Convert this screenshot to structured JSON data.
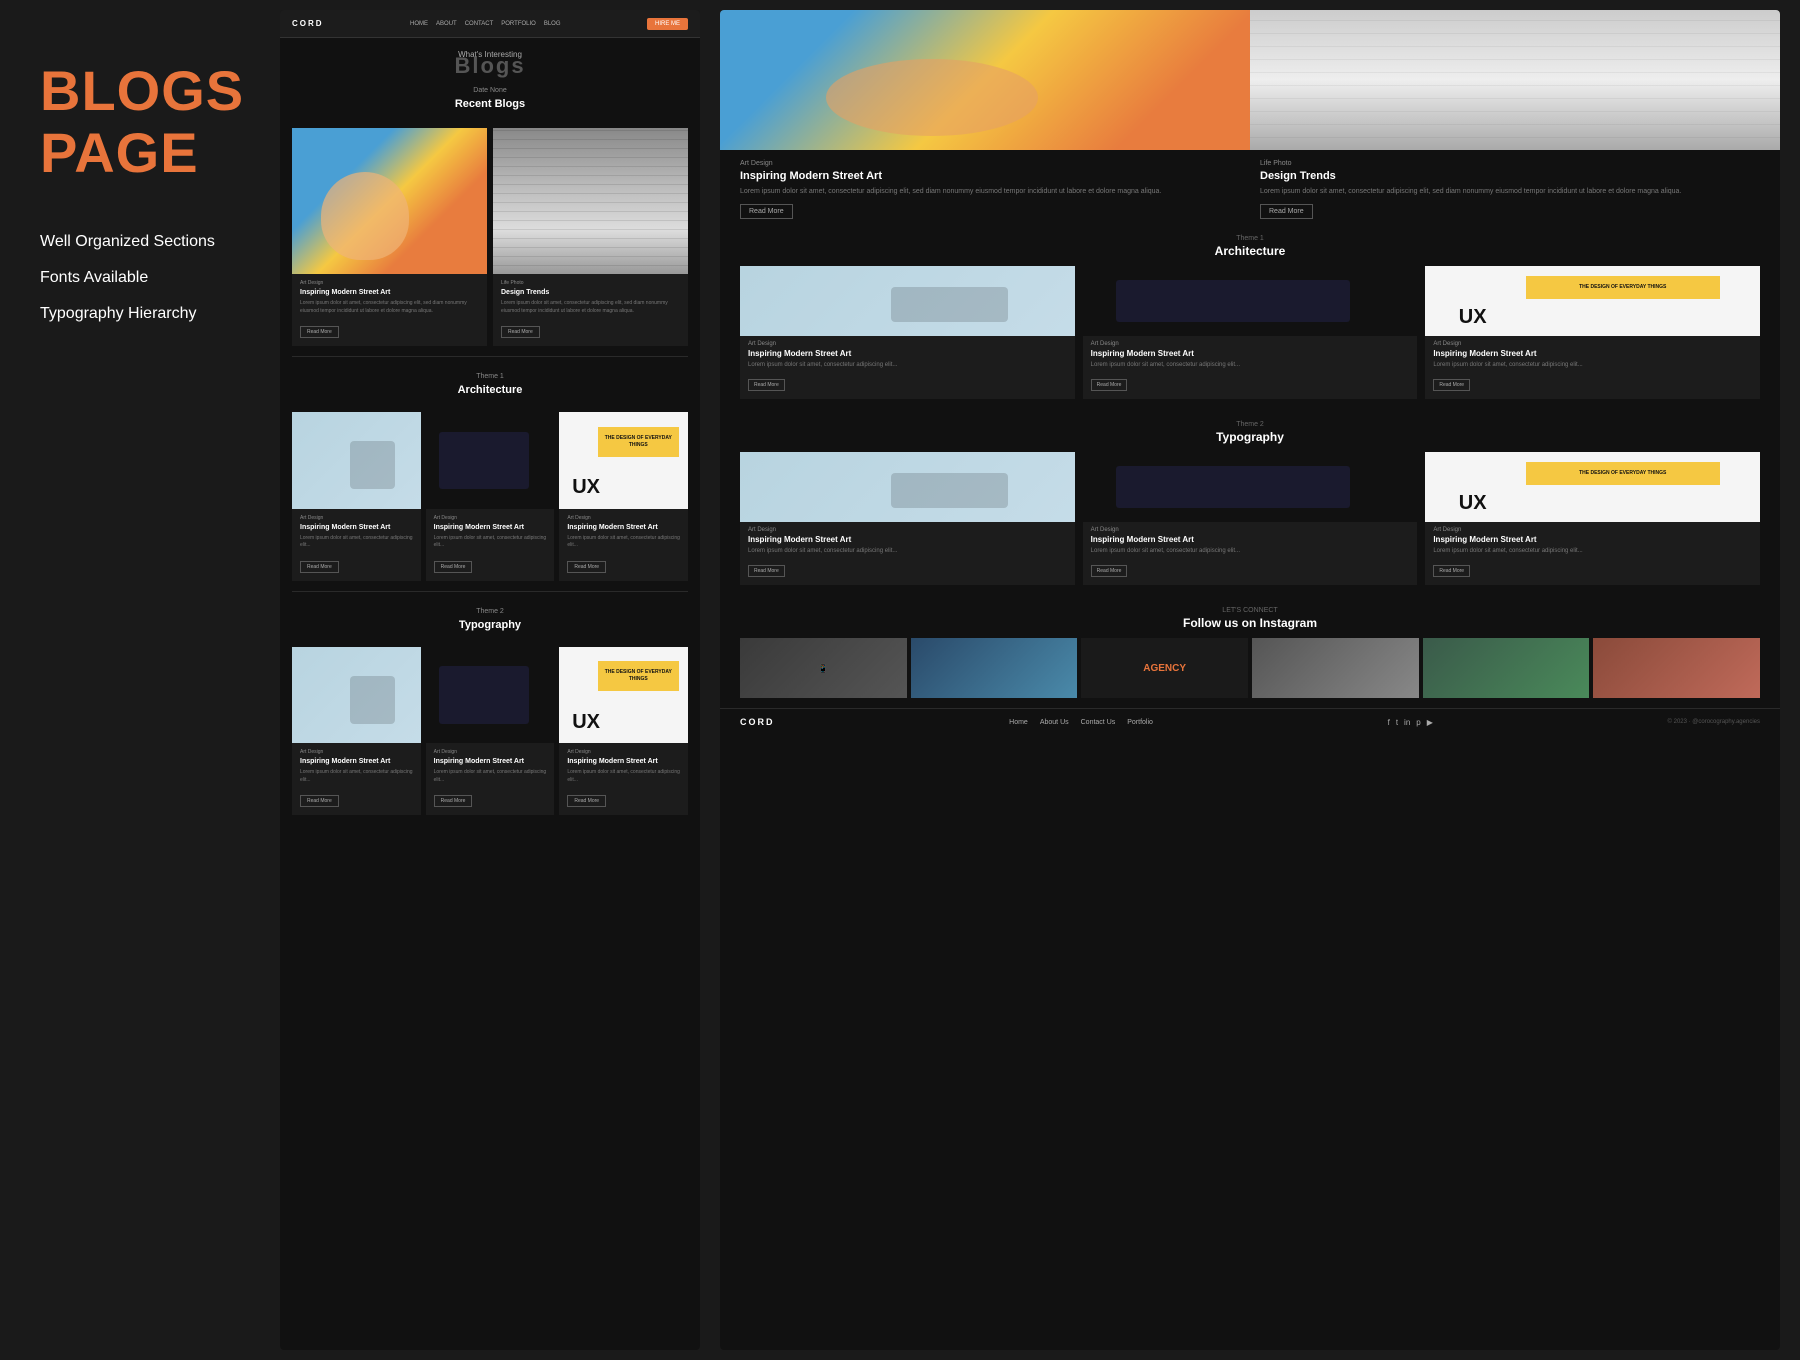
{
  "left_panel": {
    "title_line1": "BLOGS",
    "title_line2": "PAGE",
    "features": [
      "Well Organized Sections",
      "Fonts Available",
      "Typography Hierarchy"
    ]
  },
  "nav": {
    "logo": "CORD",
    "links": [
      "HOME",
      "ABOUT",
      "CONTACT",
      "PORTFOLIO",
      "BLOG"
    ],
    "cta": "HIRE ME"
  },
  "hero": {
    "subtitle": "What's Interesting",
    "title": "Blogs",
    "section_label": "Date None",
    "section_title": "Recent Blogs"
  },
  "architecture_section": {
    "label": "Theme 1",
    "title": "Architecture"
  },
  "typography_section": {
    "label": "Theme 2",
    "title": "Typography"
  },
  "blog_cards": [
    {
      "tag": "Art Design",
      "title": "Inspiring Modern Street Art",
      "text": "Lorem ipsum dolor sit amet, consectetur adipiscing elit, sed diam nonummy eiusmod tempor incididunt ut labore et dolore magna aliqua.",
      "read_more": "Read More"
    },
    {
      "tag": "Life Photo",
      "title": "Design Trends",
      "text": "Lorem ipsum dolor sit amet, consectetur adipiscing elit, sed diam nonummy eiusmod tempor incididunt ut labore et dolore magna aliqua.",
      "read_more": "Read More"
    }
  ],
  "arch_cards": [
    {
      "tag": "Art Design",
      "title": "Inspiring Modern Street Art",
      "text": "Lorem ipsum dolor sit amet, consectetur adipiscing elit...",
      "read_more": "Read More"
    },
    {
      "tag": "Art Design",
      "title": "Inspiring Modern Street Art",
      "text": "Lorem ipsum dolor sit amet, consectetur adipiscing elit...",
      "read_more": "Read More"
    },
    {
      "tag": "Art Design",
      "title": "Inspiring Modern Street Art",
      "text": "Lorem ipsum dolor sit amet, consectetur adipiscing elit...",
      "read_more": "Read More"
    }
  ],
  "instagram": {
    "label": "LET'S CONNECT",
    "title": "Follow us on Instagram"
  },
  "footer": {
    "logo": "CORD",
    "links": [
      "Home",
      "About Us",
      "Contact Us",
      "Portfolio"
    ],
    "copyright": "© 2023 · @corocography.agencies",
    "socials": [
      "f",
      "t",
      "in",
      "p",
      "yt"
    ]
  }
}
